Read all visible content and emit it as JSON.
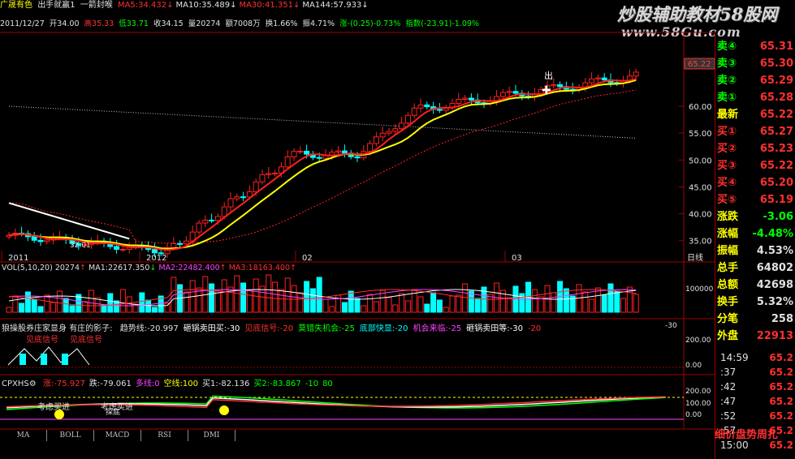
{
  "header": {
    "stock_name": "广晟有色",
    "indicator": "出手就赢1",
    "indicator_label": "一箭封喉",
    "ma": [
      {
        "label": "MA5",
        "value": "34.432",
        "dir": "↓",
        "color": "#ff3030"
      },
      {
        "label": "MA10",
        "value": "35.489",
        "dir": "↓",
        "color": "#e0e0e0"
      },
      {
        "label": "MA30",
        "value": "41.351",
        "dir": "↓",
        "color": "#ff3030"
      },
      {
        "label": "MA144",
        "value": "57.933",
        "dir": "↓",
        "color": "#e0e0e0"
      }
    ],
    "date": "2011/12/27",
    "open": "开34.00",
    "high": "高35.33",
    "low": "低33.71",
    "close": "收34.15",
    "volume": "量20274",
    "amount": "额7008万",
    "turnover": "换1.66%",
    "amplitude": "振4.71%",
    "change": "涨-(0.25)-0.73%",
    "index": "指数(-23.91)-1.09%"
  },
  "watermark": {
    "title": "炒股辅助教材58股网",
    "url": "www.58Gu.com"
  },
  "price_axis": {
    "labels": [
      "60.00",
      "55.00",
      "50.00",
      "45.00",
      "40.00",
      "35.00"
    ],
    "current_price_tag": "65.22",
    "low_marker": "32.01",
    "high_marker": "出"
  },
  "date_axis": {
    "labels": [
      "2011",
      "2012",
      "02",
      "03"
    ],
    "period": "日线"
  },
  "volume_panel": {
    "title": "VOL(5,10,20)",
    "vol": "20274",
    "ma1": "MA1:22617.350",
    "ma2": "MA2:22482.400",
    "ma3": "MA3:18163.400",
    "axis_label": "100000"
  },
  "panel3": {
    "name": "狼操股券庄家显身",
    "subtitle": "有庄的影子:",
    "items": [
      {
        "text": "趋势线:-20.997",
        "color": "#e0e0e0"
      },
      {
        "text": "砸锅卖田买:-30",
        "color": "#ffffff"
      },
      {
        "text": "见底信号:-20",
        "color": "#ff3030"
      },
      {
        "text": "莫错失机会:-25",
        "color": "#00ff00"
      },
      {
        "text": "底部快显:-20",
        "color": "#00ffff"
      },
      {
        "text": "机会来临:-25",
        "color": "#ff40ff"
      },
      {
        "text": "砸锅卖田等:-30",
        "color": "#ffffff"
      },
      {
        "text": "-20",
        "color": "#ff3030"
      }
    ],
    "right_value": "-30",
    "signal_text": "见底信号",
    "axis_labels": [
      "200.00",
      "0.00"
    ]
  },
  "panel4": {
    "name": "CPXHS",
    "items": [
      {
        "text": "涨:-75.927",
        "color": "#ff3030"
      },
      {
        "text": "跌:-79.061",
        "color": "#e0e0e0"
      },
      {
        "text": "多线:0",
        "color": "#ff40ff"
      },
      {
        "text": "空线:100",
        "color": "#ffff00"
      },
      {
        "text": "买1:-82.136",
        "color": "#e0e0e0"
      },
      {
        "text": "买2:-83.867",
        "color": "#00ff00"
      },
      {
        "text": "-10",
        "color": "#00ff00"
      },
      {
        "text": "80",
        "color": "#00ff00"
      }
    ],
    "notes": [
      "考虑买进",
      "考虑买进",
      "探底"
    ],
    "axis_labels": [
      "200.00",
      "100.00",
      "0.00"
    ]
  },
  "tabs": [
    "MA",
    "BOLL",
    "MACD",
    "RSI",
    "DMI"
  ],
  "quotes": {
    "sell": [
      {
        "label": "卖④",
        "value": "65.31"
      },
      {
        "label": "卖③",
        "value": "65.30"
      },
      {
        "label": "卖②",
        "value": "65.29"
      },
      {
        "label": "卖①",
        "value": "65.28"
      }
    ],
    "latest": {
      "label": "最新",
      "value": "65.22"
    },
    "buy": [
      {
        "label": "买①",
        "value": "65.27"
      },
      {
        "label": "买②",
        "value": "65.23"
      },
      {
        "label": "买③",
        "value": "65.22"
      },
      {
        "label": "买④",
        "value": "65.20"
      },
      {
        "label": "买⑤",
        "value": "65.19"
      }
    ],
    "stats": [
      {
        "label": "涨跌",
        "value": "-3.06",
        "color": "#00ff00"
      },
      {
        "label": "涨幅",
        "value": "-4.48%",
        "color": "#00ff00"
      },
      {
        "label": "振幅",
        "value": "4.53%",
        "color": "#e0e0e0"
      },
      {
        "label": "总手",
        "value": "64802",
        "color": "#e0e0e0"
      },
      {
        "label": "总额",
        "value": "42698",
        "color": "#e0e0e0"
      },
      {
        "label": "换手",
        "value": "5.32%",
        "color": "#e0e0e0"
      },
      {
        "label": "分笔",
        "value": "258",
        "color": "#e0e0e0"
      },
      {
        "label": "外盘",
        "value": "22913",
        "color": "#ff3030"
      }
    ],
    "ticks": [
      {
        "time": "14:59",
        "price": "65.2"
      },
      {
        "time": ":37",
        "price": "65.2"
      },
      {
        "time": ":42",
        "price": "65.2"
      },
      {
        "time": ":47",
        "price": "65.2"
      },
      {
        "time": ":52",
        "price": "65.2"
      },
      {
        "time": ":57",
        "price": "65.2"
      },
      {
        "time": "15:00",
        "price": "65.2"
      }
    ],
    "bottom_tabs": "细价盘势周扎"
  },
  "colors": {
    "up": "#ff2020",
    "down": "#00ffff",
    "ma5": "#ffffff",
    "ma10": "#ffff00",
    "ma30": "#ff2020",
    "ma144": "#c0c0c0",
    "grid": "#a00000"
  }
}
